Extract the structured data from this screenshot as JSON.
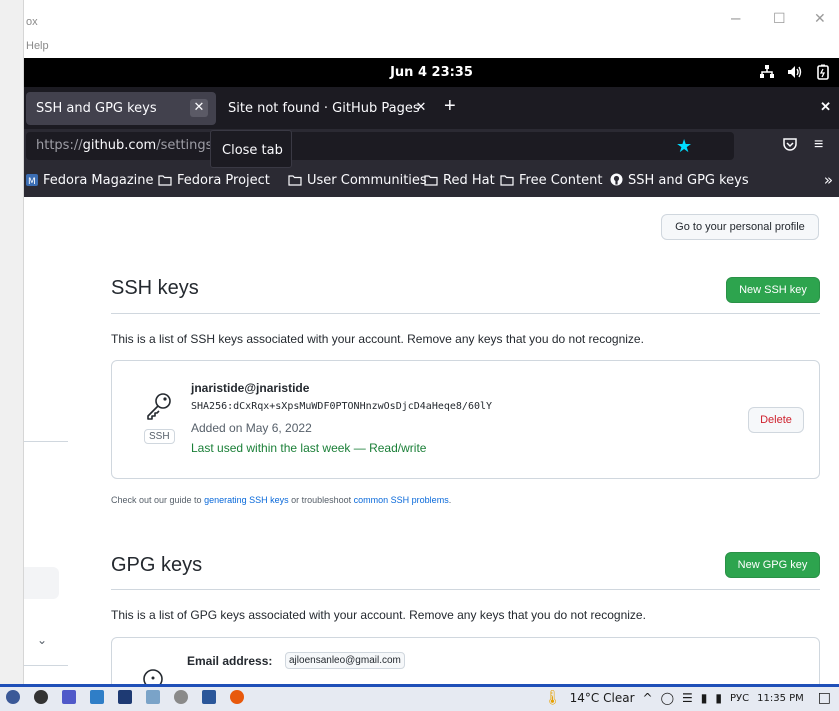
{
  "host_window": {
    "app_fragment": "ox",
    "menu": "Help",
    "controls": {
      "minimize": "–",
      "maximize": "☐",
      "close": "✕"
    }
  },
  "gnome": {
    "clock": "Jun 4  23:35",
    "tray_icons": [
      "network-icon",
      "volume-icon",
      "battery-icon"
    ]
  },
  "browser": {
    "tabs": [
      {
        "label": "SSH and GPG keys",
        "active": true,
        "close": "✕"
      },
      {
        "label": "Site not found · GitHub Pages",
        "active": false,
        "close": "✕"
      }
    ],
    "new_tab": "+",
    "strip_close": "✕",
    "url_prefix": "https://",
    "url_host": "github.com",
    "url_rest": "/settings",
    "tooltip": "Close tab",
    "menu_icon": "≡",
    "bookmarks": [
      {
        "label": "Fedora Magazine",
        "icon": "fedora-icon"
      },
      {
        "label": "Fedora Project",
        "icon": "folder-icon"
      },
      {
        "label": "User Communities",
        "icon": "folder-icon"
      },
      {
        "label": "Red Hat",
        "icon": "folder-icon"
      },
      {
        "label": "Free Content",
        "icon": "folder-icon"
      },
      {
        "label": "SSH and GPG keys",
        "icon": "github-icon"
      }
    ],
    "bookmarks_more": "»"
  },
  "page": {
    "profile_button": "Go to your personal profile",
    "ssh": {
      "title": "SSH keys",
      "new_button": "New SSH key",
      "description": "This is a list of SSH keys associated with your account. Remove any keys that you do not recognize.",
      "key": {
        "title": "jnaristide@jnaristide",
        "fingerprint": "SHA256:dCxRqx+sXpsMuWDF0PTONHnzwOsDjcD4aHeqe8/60lY",
        "added": "Added on May 6, 2022",
        "last_used": "Last used within the last week — Read/write",
        "badge": "SSH",
        "delete_button": "Delete"
      },
      "guide_prefix": "Check out our guide to ",
      "guide_link1": "generating SSH keys",
      "guide_middle": " or troubleshoot ",
      "guide_link2": "common SSH problems",
      "guide_suffix": "."
    },
    "gpg": {
      "title": "GPG keys",
      "new_button": "New GPG key",
      "description": "This is a list of GPG keys associated with your account. Remove any keys that you do not recognize.",
      "email_label": "Email address:",
      "email": "ajloensanleo@gmail.com"
    }
  },
  "taskbar": {
    "weather": "14°C  Clear",
    "chevron": "^",
    "language": "РУС",
    "time": "11:35 PM",
    "colors": {
      "accent": "#1f4fb8"
    }
  }
}
